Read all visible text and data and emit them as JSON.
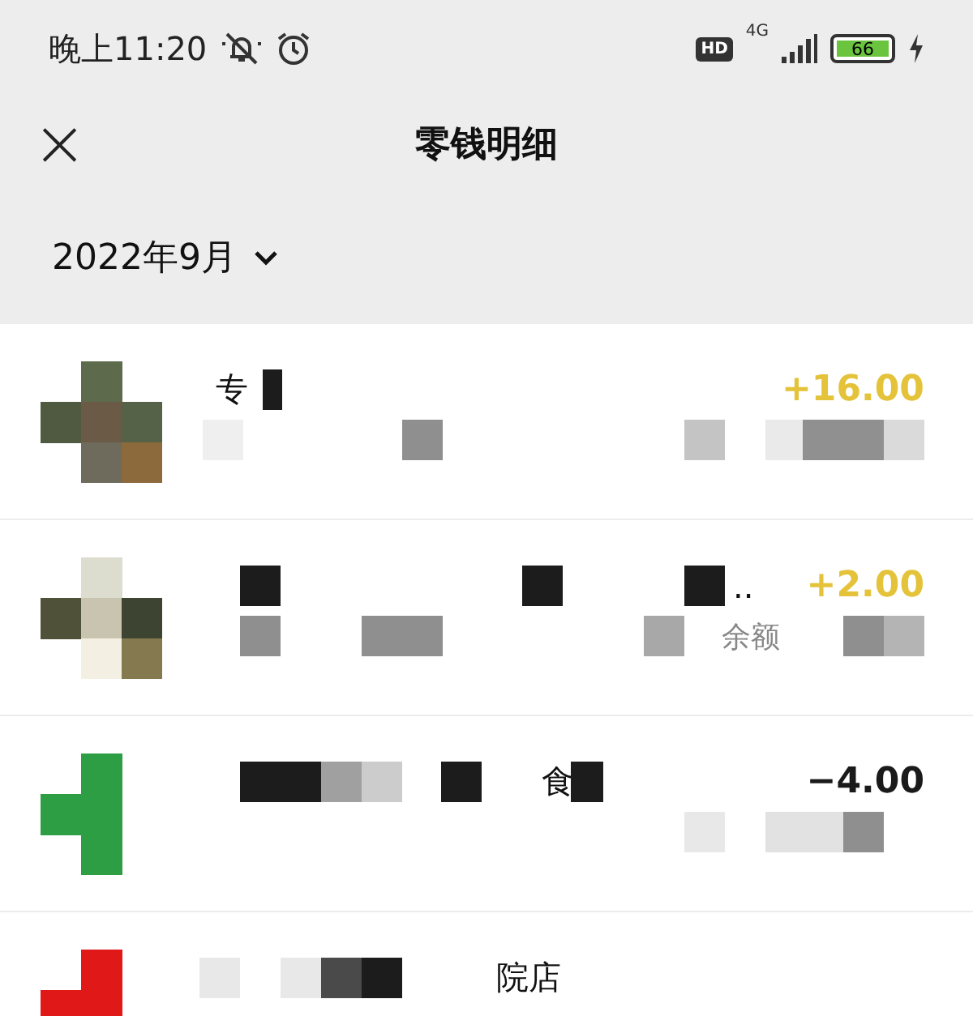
{
  "status_bar": {
    "time": "晚上11:20",
    "hd": "HD",
    "network": "4G",
    "battery": "66",
    "charging": true
  },
  "header": {
    "close": "×",
    "title": "零钱明细"
  },
  "month": "2022年9月",
  "transactions": [
    {
      "title_parts": [
        "专"
      ],
      "amount": "+16.00",
      "kind": "income"
    },
    {
      "title_parts": [
        ".."
      ],
      "subtitle_parts": [
        "余额"
      ],
      "amount": "+2.00",
      "kind": "income"
    },
    {
      "title_parts": [
        "食"
      ],
      "amount": "−4.00",
      "kind": "expense"
    },
    {
      "title_parts": [
        "院店"
      ]
    }
  ]
}
